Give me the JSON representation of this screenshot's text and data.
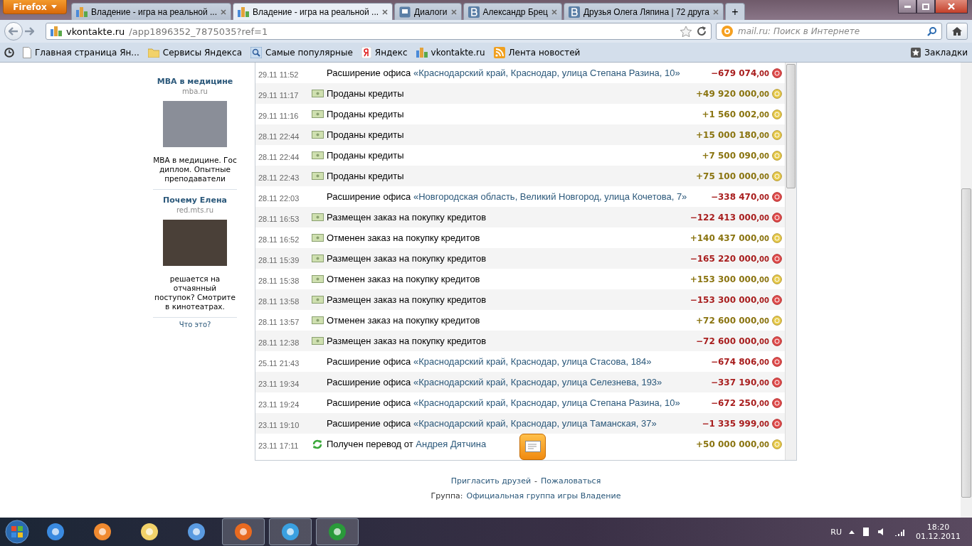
{
  "browser": {
    "menu_button": "Firefox",
    "tabs": [
      {
        "title": "Владение - игра на реальной ...",
        "selected": false
      },
      {
        "title": "Владение - игра на реальной ...",
        "selected": true
      },
      {
        "title": "Диалоги",
        "selected": false
      },
      {
        "title": "Александр Брец",
        "selected": false
      },
      {
        "title": "Друзья Олега Ляпина | 72 друга",
        "selected": false
      }
    ],
    "new_tab": "+",
    "address": {
      "host": "vkontakte.ru",
      "path": "/app1896352_7875035?ref=1"
    },
    "search": {
      "placeholder": "mail.ru: Поиск в Интернете"
    },
    "bookmarks": [
      "Главная страница Ян...",
      "Сервисы Яндекса",
      "Самые популярные",
      "Яндекс",
      "vkontakte.ru",
      "Лента новостей"
    ],
    "bookmarks_menu": "Закладки"
  },
  "ads": [
    {
      "title": "MBA в медицине",
      "domain": "mba.ru",
      "text": "MBA в медицине. Гос диплом. Опытные преподаватели"
    },
    {
      "title": "Почему Елена",
      "domain": "red.mts.ru",
      "text": "решается на отчаянный поступок? Смотрите в кинотеатрах."
    }
  ],
  "ads_help": "Что это?",
  "transactions": [
    {
      "time": "29.11 11:52",
      "kind": "office",
      "text": "Расширение офиса",
      "link": "«Краснодарский край, Краснодар, улица Степана Разина, 10»",
      "amount": "−679 074",
      "cents": ",00"
    },
    {
      "time": "29.11 11:17",
      "kind": "sale",
      "text": "Проданы кредиты",
      "amount": "+49 920 000",
      "cents": ",00"
    },
    {
      "time": "29.11 11:16",
      "kind": "sale",
      "text": "Проданы кредиты",
      "amount": "+1 560 002",
      "cents": ",00"
    },
    {
      "time": "28.11 22:44",
      "kind": "sale",
      "text": "Проданы кредиты",
      "amount": "+15 000 180",
      "cents": ",00"
    },
    {
      "time": "28.11 22:44",
      "kind": "sale",
      "text": "Проданы кредиты",
      "amount": "+7 500 090",
      "cents": ",00"
    },
    {
      "time": "28.11 22:43",
      "kind": "sale",
      "text": "Проданы кредиты",
      "amount": "+75 100 000",
      "cents": ",00"
    },
    {
      "time": "28.11 22:03",
      "kind": "office",
      "text": "Расширение офиса",
      "link": "«Новгородская область, Великий Новгород, улица Кочетова, 7»",
      "amount": "−338 470",
      "cents": ",00"
    },
    {
      "time": "28.11 16:53",
      "kind": "order",
      "text": "Размещен заказ на покупку кредитов",
      "amount": "−122 413 000",
      "cents": ",00"
    },
    {
      "time": "28.11 16:52",
      "kind": "cancel",
      "text": "Отменен заказ на покупку кредитов",
      "amount": "+140 437 000",
      "cents": ",00"
    },
    {
      "time": "28.11 15:39",
      "kind": "order",
      "text": "Размещен заказ на покупку кредитов",
      "amount": "−165 220 000",
      "cents": ",00"
    },
    {
      "time": "28.11 15:38",
      "kind": "cancel",
      "text": "Отменен заказ на покупку кредитов",
      "amount": "+153 300 000",
      "cents": ",00"
    },
    {
      "time": "28.11 13:58",
      "kind": "order",
      "text": "Размещен заказ на покупку кредитов",
      "amount": "−153 300 000",
      "cents": ",00"
    },
    {
      "time": "28.11 13:57",
      "kind": "cancel",
      "text": "Отменен заказ на покупку кредитов",
      "amount": "+72 600 000",
      "cents": ",00"
    },
    {
      "time": "28.11 12:38",
      "kind": "order",
      "text": "Размещен заказ на покупку кредитов",
      "amount": "−72 600 000",
      "cents": ",00"
    },
    {
      "time": "25.11 21:43",
      "kind": "office",
      "text": "Расширение офиса",
      "link": "«Краснодарский край, Краснодар, улица Стасова, 184»",
      "amount": "−674 806",
      "cents": ",00"
    },
    {
      "time": "23.11 19:34",
      "kind": "office",
      "text": "Расширение офиса",
      "link": "«Краснодарский край, Краснодар, улица Селезнева, 193»",
      "amount": "−337 190",
      "cents": ",00"
    },
    {
      "time": "23.11 19:24",
      "kind": "office",
      "text": "Расширение офиса",
      "link": "«Краснодарский край, Краснодар, улица Степана Разина, 10»",
      "amount": "−672 250",
      "cents": ",00"
    },
    {
      "time": "23.11 19:10",
      "kind": "office",
      "text": "Расширение офиса",
      "link": "«Краснодарский край, Краснодар, улица Таманская, 37»",
      "amount": "−1 335 999",
      "cents": ",00"
    },
    {
      "time": "23.11 17:11",
      "kind": "transfer",
      "text": "Получен перевод от",
      "link": "Андрея Дятчина",
      "amount": "+50 000 000",
      "cents": ",00"
    }
  ],
  "footer": {
    "links": [
      "Пригласить друзей",
      "Пожаловаться"
    ],
    "separator": "-",
    "group_label": "Группа:",
    "group_link": "Официальная группа игры Владение"
  },
  "taskbar": {
    "apps": [
      {
        "selected": false
      },
      {
        "selected": false
      },
      {
        "selected": false
      },
      {
        "selected": false
      },
      {
        "selected": true
      },
      {
        "selected": true
      },
      {
        "selected": true
      }
    ],
    "language": "RU",
    "time": "18:20",
    "date": "01.12.2011"
  }
}
